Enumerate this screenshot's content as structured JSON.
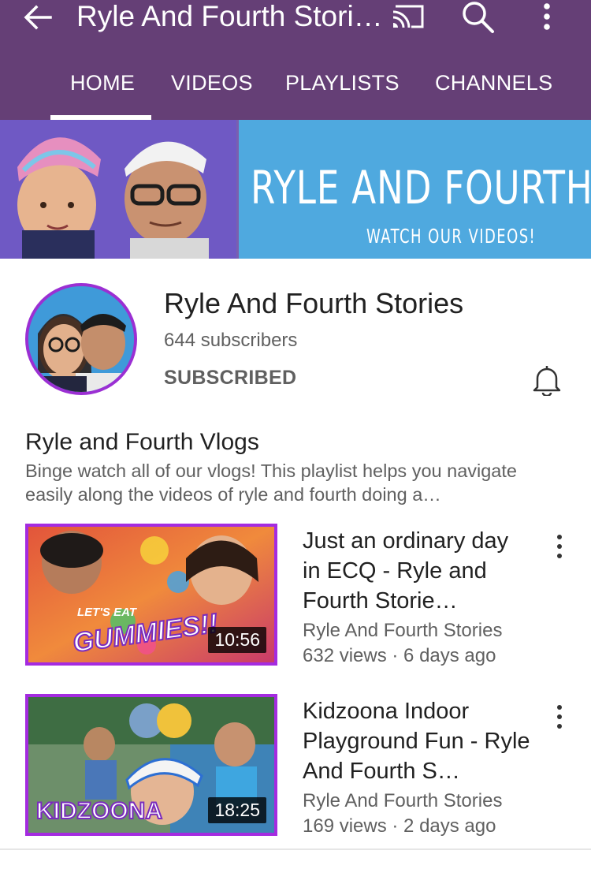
{
  "appbar": {
    "title": "Ryle And Fourth Stori…",
    "icons": [
      "back-arrow-icon",
      "cast-icon",
      "search-icon",
      "more-vert-icon"
    ],
    "background": "#653f76"
  },
  "tabs": [
    {
      "label": "HOME",
      "selected": true
    },
    {
      "label": "VIDEOS",
      "selected": false
    },
    {
      "label": "PLAYLISTS",
      "selected": false
    },
    {
      "label": "CHANNELS",
      "selected": false
    }
  ],
  "banner": {
    "title": "RYLE AND FOURTH STO",
    "subtitle": "WATCH OUR VIDEOS!"
  },
  "channel": {
    "name": "Ryle And Fourth Stories",
    "subscribers": "644 subscribers",
    "subscribe_state": "SUBSCRIBED"
  },
  "playlist": {
    "title": "Ryle and Fourth Vlogs",
    "description": "Binge watch all of our vlogs! This playlist helps you navigate easily along the videos of ryle and fourth doing a…"
  },
  "videos": [
    {
      "title": "Just an ordinary day in ECQ - Ryle and Fourth Storie…",
      "channel": "Ryle And Fourth Stories",
      "meta": "632 views · 6 days ago",
      "duration": "10:56",
      "thumb_text_top": "LET'S EAT",
      "thumb_text_main": "GUMMIES!!"
    },
    {
      "title": "Kidzoona Indoor Playground Fun - Ryle And Fourth S…",
      "channel": "Ryle And Fourth Stories",
      "meta": "169 views · 2 days ago",
      "duration": "18:25",
      "thumb_text_main": "KIDZOONA"
    }
  ]
}
